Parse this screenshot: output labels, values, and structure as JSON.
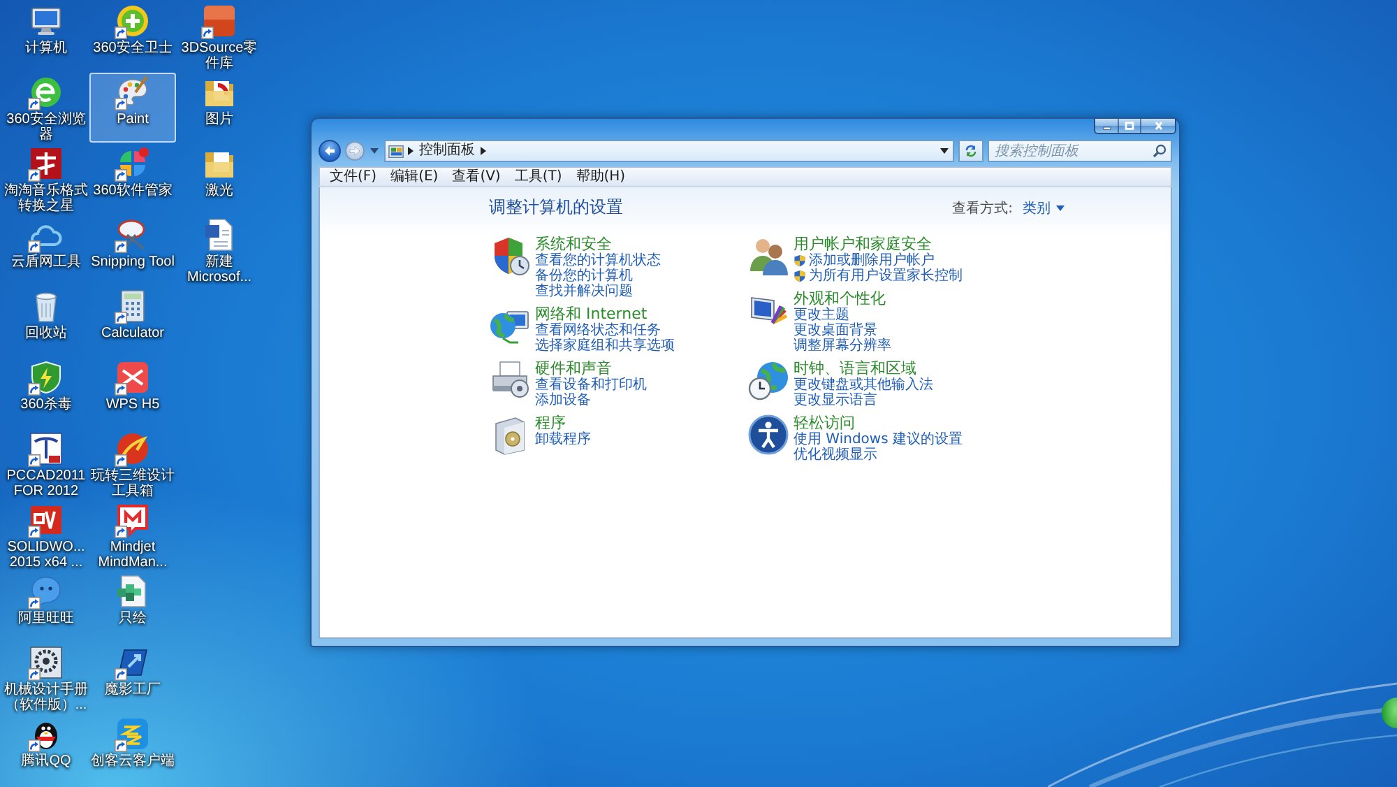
{
  "desktop_icons": [
    {
      "label": "计算机",
      "shortcut": false,
      "selected": false
    },
    {
      "label": "360安全浏览器",
      "shortcut": true,
      "selected": false
    },
    {
      "label": "淘淘音乐格式转换之星",
      "shortcut": true,
      "selected": false
    },
    {
      "label": "云盾网工具",
      "shortcut": true,
      "selected": false
    },
    {
      "label": "回收站",
      "shortcut": false,
      "selected": false
    },
    {
      "label": "360杀毒",
      "shortcut": true,
      "selected": false
    },
    {
      "label": "PCCAD2011 FOR 2012",
      "shortcut": true,
      "selected": false
    },
    {
      "label": "SOLIDWO... 2015 x64 ...",
      "shortcut": true,
      "selected": false
    },
    {
      "label": "阿里旺旺",
      "shortcut": true,
      "selected": false
    },
    {
      "label": "机械设计手册（软件版）...",
      "shortcut": true,
      "selected": false
    },
    {
      "label": "腾讯QQ",
      "shortcut": true,
      "selected": false
    },
    {
      "label": "360安全卫士",
      "shortcut": true,
      "selected": false
    },
    {
      "label": "Paint",
      "shortcut": true,
      "selected": true
    },
    {
      "label": "360软件管家",
      "shortcut": true,
      "selected": false
    },
    {
      "label": "Snipping Tool",
      "shortcut": true,
      "selected": false
    },
    {
      "label": "Calculator",
      "shortcut": true,
      "selected": false
    },
    {
      "label": "WPS H5",
      "shortcut": true,
      "selected": false
    },
    {
      "label": "玩转三维设计工具箱",
      "shortcut": true,
      "selected": false
    },
    {
      "label": "Mindjet MindMan...",
      "shortcut": true,
      "selected": false
    },
    {
      "label": "只绘",
      "shortcut": false,
      "selected": false
    },
    {
      "label": "魔影工厂",
      "shortcut": true,
      "selected": false
    },
    {
      "label": "创客云客户端",
      "shortcut": true,
      "selected": false
    },
    {
      "label": "3DSource零件库",
      "shortcut": true,
      "selected": false
    },
    {
      "label": "图片",
      "shortcut": false,
      "selected": false
    },
    {
      "label": "激光",
      "shortcut": false,
      "selected": false
    },
    {
      "label": "新建 Microsof...",
      "shortcut": false,
      "selected": false
    }
  ],
  "window": {
    "nav_buttons": [
      {
        "kind": "back",
        "disabled": false
      },
      {
        "kind": "forward",
        "disabled": true
      }
    ],
    "breadcrumb": "控制面板",
    "search": {
      "placeholder": "搜索控制面板"
    },
    "menu": [
      "文件(F)",
      "编辑(E)",
      "查看(V)",
      "工具(T)",
      "帮助(H)"
    ]
  },
  "control_panel": {
    "heading": "调整计算机的设置",
    "view_by": {
      "label": "查看方式:",
      "value": "类别"
    },
    "columns": [
      {
        "categories": [
          {
            "title": "系统和安全",
            "links": [
              {
                "text": "查看您的计算机状态",
                "shield": false
              },
              {
                "text": "备份您的计算机",
                "shield": false
              },
              {
                "text": "查找并解决问题",
                "shield": false
              }
            ]
          },
          {
            "title": "网络和 Internet",
            "links": [
              {
                "text": "查看网络状态和任务",
                "shield": false
              },
              {
                "text": "选择家庭组和共享选项",
                "shield": false
              }
            ]
          },
          {
            "title": "硬件和声音",
            "links": [
              {
                "text": "查看设备和打印机",
                "shield": false
              },
              {
                "text": "添加设备",
                "shield": false
              }
            ]
          },
          {
            "title": "程序",
            "links": [
              {
                "text": "卸载程序",
                "shield": false
              }
            ]
          }
        ]
      },
      {
        "categories": [
          {
            "title": "用户帐户和家庭安全",
            "links": [
              {
                "text": "添加或删除用户帐户",
                "shield": true
              },
              {
                "text": "为所有用户设置家长控制",
                "shield": true
              }
            ]
          },
          {
            "title": "外观和个性化",
            "links": [
              {
                "text": "更改主题",
                "shield": false
              },
              {
                "text": "更改桌面背景",
                "shield": false
              },
              {
                "text": "调整屏幕分辨率",
                "shield": false
              }
            ]
          },
          {
            "title": "时钟、语言和区域",
            "links": [
              {
                "text": "更改键盘或其他输入法",
                "shield": false
              },
              {
                "text": "更改显示语言",
                "shield": false
              }
            ]
          },
          {
            "title": "轻松访问",
            "links": [
              {
                "text": "使用 Windows 建议的设置",
                "shield": false
              },
              {
                "text": "优化视频显示",
                "shield": false
              }
            ]
          }
        ]
      }
    ]
  }
}
